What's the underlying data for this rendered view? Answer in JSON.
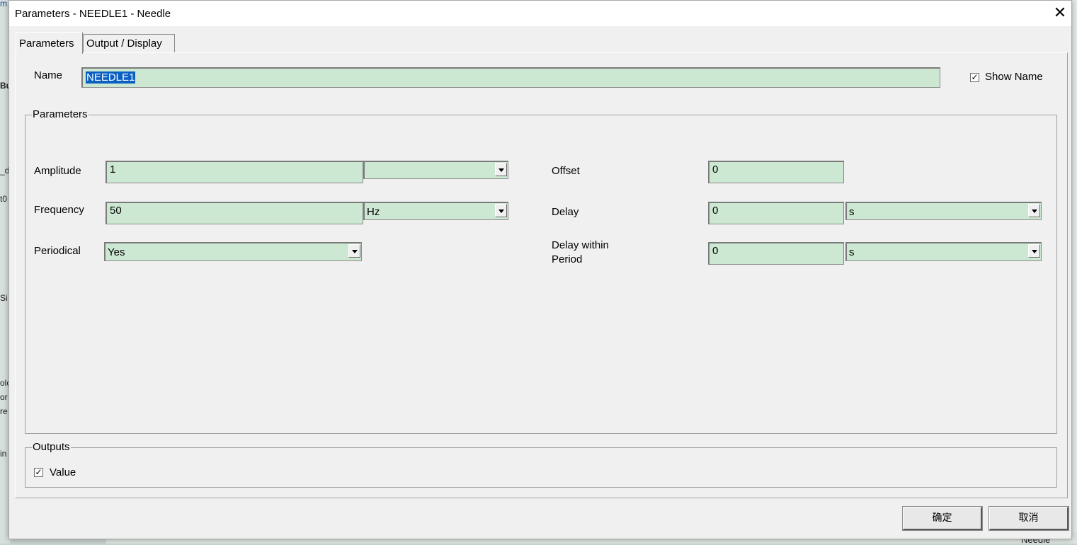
{
  "window": {
    "title": "Parameters - NEEDLE1 - Needle",
    "close_glyph": "✕"
  },
  "tabs": [
    {
      "label": "Parameters"
    },
    {
      "label": "Output / Display"
    }
  ],
  "name_row": {
    "label": "Name",
    "value": "NEEDLE1",
    "show_name_label": "Show Name",
    "show_name_checked": true
  },
  "parameters_group": {
    "title": "Parameters",
    "amplitude": {
      "label": "Amplitude",
      "value": "1",
      "unit": ""
    },
    "frequency": {
      "label": "Frequency",
      "value": "50",
      "unit": "Hz"
    },
    "periodical": {
      "label": "Periodical",
      "value": "Yes"
    },
    "offset": {
      "label": "Offset",
      "value": "0"
    },
    "delay": {
      "label": "Delay",
      "value": "0",
      "unit": "s"
    },
    "delay_within_period": {
      "label_line1": "Delay within",
      "label_line2": "Period",
      "value": "0",
      "unit": "s"
    }
  },
  "outputs_group": {
    "title": "Outputs",
    "value_label": "Value",
    "value_checked": true
  },
  "buttons": {
    "ok": "确定",
    "cancel": "取消"
  },
  "checkmark": "✓",
  "background": {
    "frag1": "m",
    "frag2": "Bu",
    "frag3": "_d",
    "frag4": "t0",
    "frag5": "Si",
    "frag6": "olc",
    "frag7": "or",
    "frag8": "re",
    "frag9": "in",
    "bottom_right": "Needle"
  },
  "colors": {
    "field_bg": "#cde8d2",
    "selection": "#0a5fc2",
    "dialog_bg": "#f0f0f0"
  }
}
